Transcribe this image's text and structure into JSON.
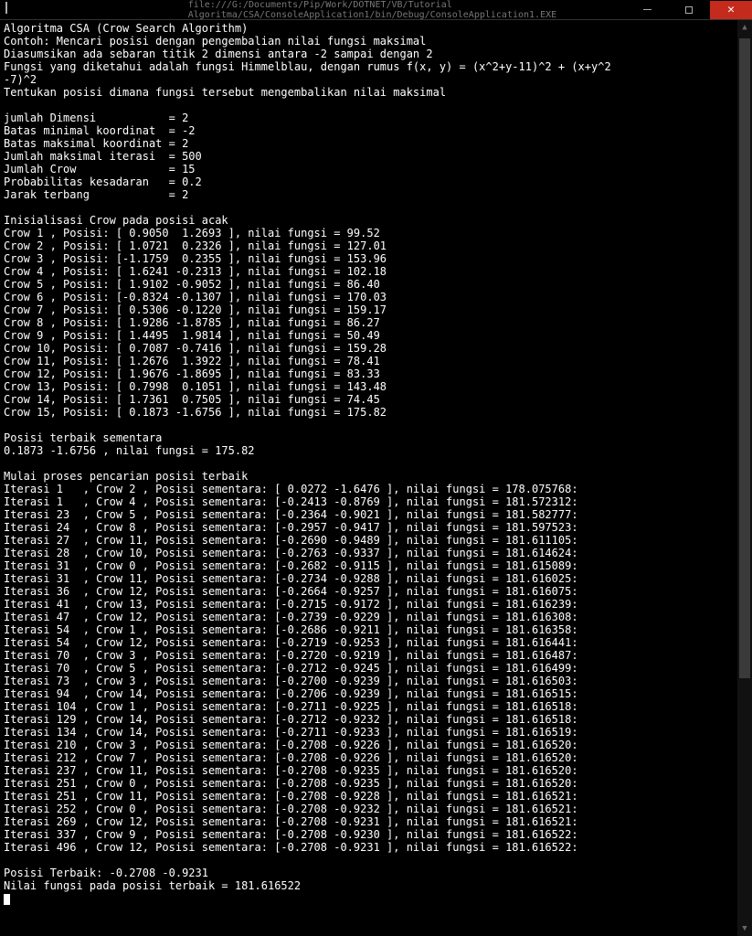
{
  "window": {
    "title_path": "file:///G:/Documents/Pip/Work/DOTNET/VB/Tutorial Algoritma/CSA/ConsoleApplication1/bin/Debug/ConsoleApplication1.EXE"
  },
  "header_lines": [
    "Algoritma CSA (Crow Search Algorithm)",
    "Contoh: Mencari posisi dengan pengembalian nilai fungsi maksimal",
    "Diasumsikan ada sebaran titik 2 dimensi antara -2 sampai dengan 2",
    "Fungsi yang diketahui adalah fungsi Himmelblau, dengan rumus f(x, y) = (x^2+y-11)^2 + (x+y^2",
    "-7)^2",
    "Tentukan posisi dimana fungsi tersebut mengembalikan nilai maksimal"
  ],
  "params": [
    {
      "k": "jumlah Dimensi",
      "v": "2"
    },
    {
      "k": "Batas minimal koordinat",
      "v": "-2"
    },
    {
      "k": "Batas maksimal koordinat",
      "v": "2"
    },
    {
      "k": "Jumlah maksimal iterasi",
      "v": "500"
    },
    {
      "k": "Jumlah Crow",
      "v": "15"
    },
    {
      "k": "Probabilitas kesadaran",
      "v": "0.2"
    },
    {
      "k": "Jarak terbang",
      "v": "2"
    }
  ],
  "init_header": "Inisialisasi Crow pada posisi acak",
  "crows": [
    {
      "i": "1",
      "x": " 0.9050",
      "y": " 1.2693",
      "f": "99.52"
    },
    {
      "i": "2",
      "x": " 1.0721",
      "y": " 0.2326",
      "f": "127.01"
    },
    {
      "i": "3",
      "x": "-1.1759",
      "y": " 0.2355",
      "f": "153.96"
    },
    {
      "i": "4",
      "x": " 1.6241",
      "y": "-0.2313",
      "f": "102.18"
    },
    {
      "i": "5",
      "x": " 1.9102",
      "y": "-0.9052",
      "f": "86.40"
    },
    {
      "i": "6",
      "x": "-0.8324",
      "y": "-0.1307",
      "f": "170.03"
    },
    {
      "i": "7",
      "x": " 0.5306",
      "y": "-0.1220",
      "f": "159.17"
    },
    {
      "i": "8",
      "x": " 1.9286",
      "y": "-1.8785",
      "f": "86.27"
    },
    {
      "i": "9",
      "x": " 1.4495",
      "y": " 1.9814",
      "f": "50.49"
    },
    {
      "i": "10",
      "x": " 0.7087",
      "y": "-0.7416",
      "f": "159.28"
    },
    {
      "i": "11",
      "x": " 1.2676",
      "y": " 1.3922",
      "f": "78.41"
    },
    {
      "i": "12",
      "x": " 1.9676",
      "y": "-1.8695",
      "f": "83.33"
    },
    {
      "i": "13",
      "x": " 0.7998",
      "y": " 0.1051",
      "f": "143.48"
    },
    {
      "i": "14",
      "x": " 1.7361",
      "y": " 0.7505",
      "f": "74.45"
    },
    {
      "i": "15",
      "x": " 0.1873",
      "y": "-1.6756",
      "f": "175.82"
    }
  ],
  "best_temp_header": "Posisi terbaik sementara",
  "best_temp_line": "0.1873 -1.6756 , nilai fungsi = 175.82",
  "process_header": "Mulai proses pencarian posisi terbaik",
  "iterations": [
    {
      "it": "1",
      "crow": "2",
      "x": " 0.0272",
      "y": "-1.6476",
      "f": "178.075768"
    },
    {
      "it": "1",
      "crow": "4",
      "x": "-0.2413",
      "y": "-0.8769",
      "f": "181.572312"
    },
    {
      "it": "23",
      "crow": "5",
      "x": "-0.2364",
      "y": "-0.9021",
      "f": "181.582777"
    },
    {
      "it": "24",
      "crow": "8",
      "x": "-0.2957",
      "y": "-0.9417",
      "f": "181.597523"
    },
    {
      "it": "27",
      "crow": "11",
      "x": "-0.2690",
      "y": "-0.9489",
      "f": "181.611105"
    },
    {
      "it": "28",
      "crow": "10",
      "x": "-0.2763",
      "y": "-0.9337",
      "f": "181.614624"
    },
    {
      "it": "31",
      "crow": "0",
      "x": "-0.2682",
      "y": "-0.9115",
      "f": "181.615089"
    },
    {
      "it": "31",
      "crow": "11",
      "x": "-0.2734",
      "y": "-0.9288",
      "f": "181.616025"
    },
    {
      "it": "36",
      "crow": "12",
      "x": "-0.2664",
      "y": "-0.9257",
      "f": "181.616075"
    },
    {
      "it": "41",
      "crow": "13",
      "x": "-0.2715",
      "y": "-0.9172",
      "f": "181.616239"
    },
    {
      "it": "47",
      "crow": "12",
      "x": "-0.2739",
      "y": "-0.9229",
      "f": "181.616308"
    },
    {
      "it": "54",
      "crow": "1",
      "x": "-0.2686",
      "y": "-0.9211",
      "f": "181.616358"
    },
    {
      "it": "54",
      "crow": "12",
      "x": "-0.2719",
      "y": "-0.9253",
      "f": "181.616441"
    },
    {
      "it": "70",
      "crow": "3",
      "x": "-0.2720",
      "y": "-0.9219",
      "f": "181.616487"
    },
    {
      "it": "70",
      "crow": "5",
      "x": "-0.2712",
      "y": "-0.9245",
      "f": "181.616499"
    },
    {
      "it": "73",
      "crow": "3",
      "x": "-0.2700",
      "y": "-0.9239",
      "f": "181.616503"
    },
    {
      "it": "94",
      "crow": "14",
      "x": "-0.2706",
      "y": "-0.9239",
      "f": "181.616515"
    },
    {
      "it": "104",
      "crow": "1",
      "x": "-0.2711",
      "y": "-0.9225",
      "f": "181.616518"
    },
    {
      "it": "129",
      "crow": "14",
      "x": "-0.2712",
      "y": "-0.9232",
      "f": "181.616518"
    },
    {
      "it": "134",
      "crow": "14",
      "x": "-0.2711",
      "y": "-0.9233",
      "f": "181.616519"
    },
    {
      "it": "210",
      "crow": "3",
      "x": "-0.2708",
      "y": "-0.9226",
      "f": "181.616520"
    },
    {
      "it": "212",
      "crow": "7",
      "x": "-0.2708",
      "y": "-0.9226",
      "f": "181.616520"
    },
    {
      "it": "237",
      "crow": "11",
      "x": "-0.2708",
      "y": "-0.9235",
      "f": "181.616520"
    },
    {
      "it": "251",
      "crow": "0",
      "x": "-0.2708",
      "y": "-0.9235",
      "f": "181.616520"
    },
    {
      "it": "251",
      "crow": "11",
      "x": "-0.2708",
      "y": "-0.9228",
      "f": "181.616521"
    },
    {
      "it": "252",
      "crow": "0",
      "x": "-0.2708",
      "y": "-0.9232",
      "f": "181.616521"
    },
    {
      "it": "269",
      "crow": "12",
      "x": "-0.2708",
      "y": "-0.9231",
      "f": "181.616521"
    },
    {
      "it": "337",
      "crow": "9",
      "x": "-0.2708",
      "y": "-0.9230",
      "f": "181.616522"
    },
    {
      "it": "496",
      "crow": "12",
      "x": "-0.2708",
      "y": "-0.9231",
      "f": "181.616522"
    }
  ],
  "result": {
    "pos_label": "Posisi Terbaik: -0.2708 -0.9231",
    "val_label": "Nilai fungsi pada posisi terbaik = 181.616522"
  }
}
